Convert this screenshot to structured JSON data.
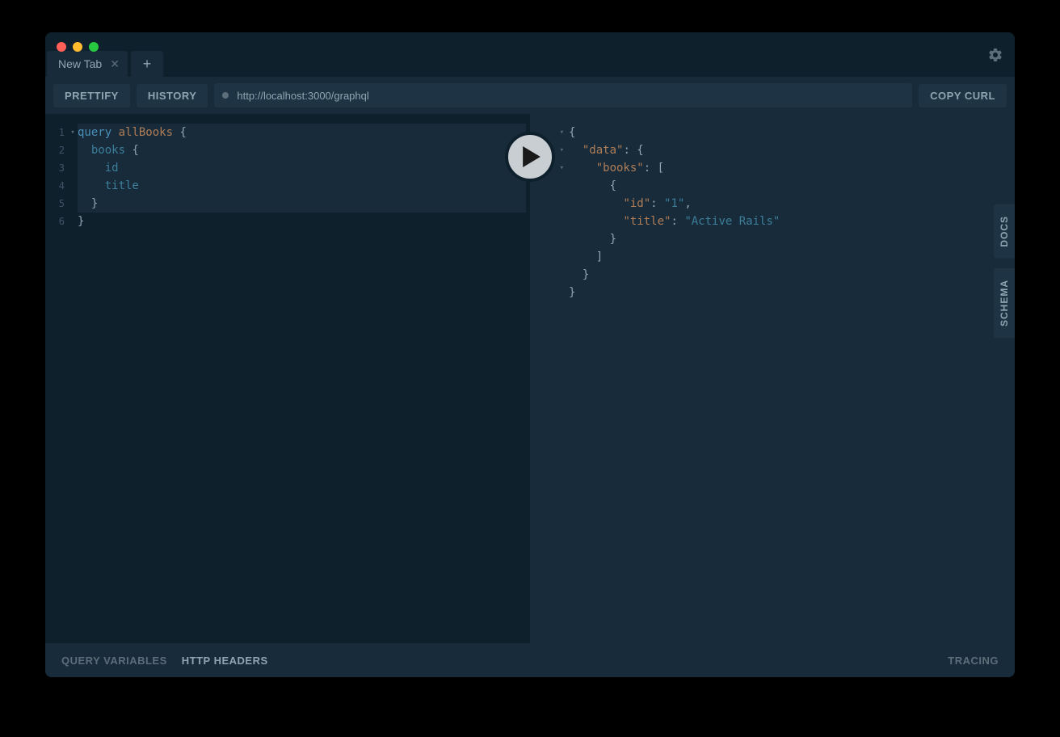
{
  "tab": {
    "label": "New Tab"
  },
  "toolbar": {
    "prettify": "PRETTIFY",
    "history": "HISTORY",
    "url": "http://localhost:3000/graphql",
    "copy_curl": "COPY CURL"
  },
  "query": {
    "lines": [
      {
        "n": "1",
        "fold": "▾",
        "tokens": [
          [
            "kw",
            "query"
          ],
          [
            "",
            ""
          ],
          [
            "name",
            " allBooks"
          ],
          [
            "",
            ""
          ],
          [
            "punc",
            " {"
          ]
        ]
      },
      {
        "n": "2",
        "fold": "",
        "tokens": [
          [
            "",
            "  "
          ],
          [
            "field",
            "books"
          ],
          [
            "",
            ""
          ],
          [
            "punc",
            " {"
          ]
        ]
      },
      {
        "n": "3",
        "fold": "",
        "tokens": [
          [
            "",
            "    "
          ],
          [
            "field",
            "id"
          ]
        ]
      },
      {
        "n": "4",
        "fold": "",
        "tokens": [
          [
            "",
            "    "
          ],
          [
            "field",
            "title"
          ]
        ]
      },
      {
        "n": "5",
        "fold": "",
        "tokens": [
          [
            "",
            "  "
          ],
          [
            "punc",
            "}"
          ]
        ]
      },
      {
        "n": "6",
        "fold": "",
        "tokens": [
          [
            "punc",
            "}"
          ]
        ]
      }
    ]
  },
  "response": {
    "lines": [
      {
        "fold": "▾",
        "tokens": [
          [
            "punc",
            "{"
          ]
        ]
      },
      {
        "fold": "▾",
        "tokens": [
          [
            "",
            "  "
          ],
          [
            "key",
            "\"data\""
          ],
          [
            "punc",
            ": {"
          ]
        ]
      },
      {
        "fold": "▾",
        "tokens": [
          [
            "",
            "    "
          ],
          [
            "key",
            "\"books\""
          ],
          [
            "punc",
            ": ["
          ]
        ]
      },
      {
        "fold": "",
        "tokens": [
          [
            "",
            "      "
          ],
          [
            "punc",
            "{"
          ]
        ]
      },
      {
        "fold": "",
        "tokens": [
          [
            "",
            "        "
          ],
          [
            "key",
            "\"id\""
          ],
          [
            "punc",
            ": "
          ],
          [
            "str",
            "\"1\""
          ],
          [
            "punc",
            ","
          ]
        ]
      },
      {
        "fold": "",
        "tokens": [
          [
            "",
            "        "
          ],
          [
            "key",
            "\"title\""
          ],
          [
            "punc",
            ": "
          ],
          [
            "str",
            "\"Active Rails\""
          ]
        ]
      },
      {
        "fold": "",
        "tokens": [
          [
            "",
            "      "
          ],
          [
            "punc",
            "}"
          ]
        ]
      },
      {
        "fold": "",
        "tokens": [
          [
            "",
            "    "
          ],
          [
            "punc",
            "]"
          ]
        ]
      },
      {
        "fold": "",
        "tokens": [
          [
            "",
            "  "
          ],
          [
            "punc",
            "}"
          ]
        ]
      },
      {
        "fold": "",
        "tokens": [
          [
            "punc",
            "}"
          ]
        ]
      }
    ]
  },
  "sidetabs": {
    "docs": "DOCS",
    "schema": "SCHEMA"
  },
  "footer": {
    "qv": "QUERY VARIABLES",
    "hh": "HTTP HEADERS",
    "tracing": "TRACING"
  }
}
